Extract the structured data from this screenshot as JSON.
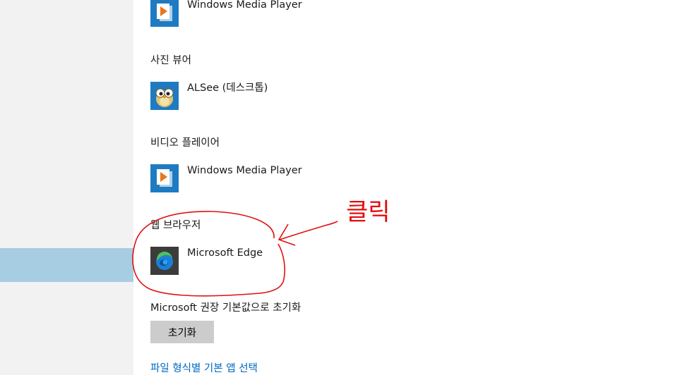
{
  "sections": {
    "music": {
      "app_name": "Windows Media Player"
    },
    "photo": {
      "label": "사진 뷰어",
      "app_name": "ALSee (데스크톱)"
    },
    "video": {
      "label": "비디오 플레이어",
      "app_name": "Windows Media Player"
    },
    "browser": {
      "label": "웹 브라우저",
      "app_name": "Microsoft Edge"
    }
  },
  "reset": {
    "label": "Microsoft 권장 기본값으로 초기화",
    "button": "초기화"
  },
  "links": {
    "file_type": "파일 형식별 기본 앱 선택"
  },
  "annotation": {
    "text": "클릭",
    "color": "#e01010"
  },
  "colors": {
    "sidebar_selected": "#a7cde3",
    "link": "#0067c0",
    "button": "#cccccc"
  },
  "icons": {
    "media_player": "windows-media-player-icon",
    "alsee": "alsee-owl-icon",
    "edge": "microsoft-edge-icon"
  }
}
